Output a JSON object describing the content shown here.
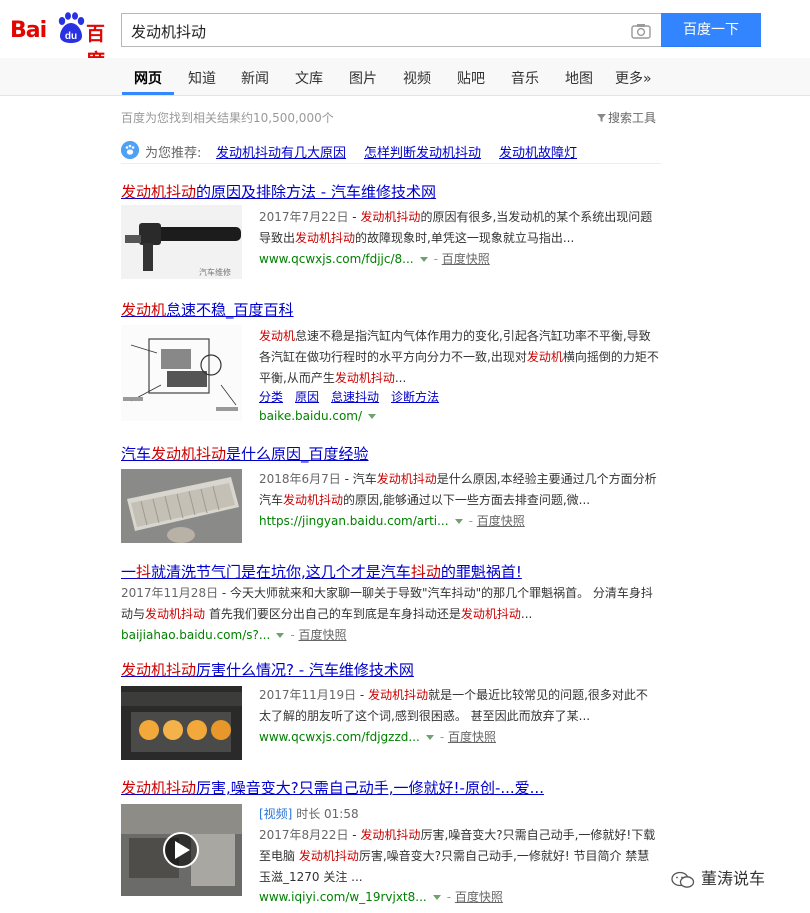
{
  "header": {
    "logo_left": "Bai",
    "logo_du": "du",
    "logo_right": "百度",
    "query": "发动机抖动",
    "search_button": "百度一下"
  },
  "tabs": [
    {
      "label": "网页",
      "active": true
    },
    {
      "label": "知道"
    },
    {
      "label": "新闻"
    },
    {
      "label": "文库"
    },
    {
      "label": "图片"
    },
    {
      "label": "视频"
    },
    {
      "label": "贴吧"
    },
    {
      "label": "音乐"
    },
    {
      "label": "地图"
    },
    {
      "label": "更多»"
    }
  ],
  "result_count": "百度为您找到相关结果约10,500,000个",
  "search_tools": "搜索工具",
  "recommend": {
    "label": "为您推荐:",
    "links": [
      "发动机抖动有几大原因",
      "怎样判断发动机抖动",
      "发动机故障灯"
    ]
  },
  "results": [
    {
      "title_hl": "发动机抖动",
      "title_rest": "的原因及排除方法 - 汽车维修技术网",
      "date": "2017年7月22日",
      "abstract_pre": " - ",
      "abstract_hl": "发动机抖动",
      "abstract_mid": "的原因有很多,当发动机的某个系统出现问题导致出",
      "abstract_hl2": "发动机抖动",
      "abstract_post": "的故障现象时,单凭这一现象就立马指出...",
      "url": "www.qcwxjs.com/fdjjc/8...",
      "snapshot": "百度快照"
    },
    {
      "title_hl": "发动机",
      "title_rest": "怠速不稳_百度百科",
      "abstract_hl": "发动机",
      "abstract_mid": "怠速不稳是指汽缸内气体作用力的变化,引起各汽缸功率不平衡,导致各汽缸在做功行程时的水平方向分力不一致,出现对",
      "abstract_hl2": "发动机",
      "abstract_mid2": "横向摇倒的力矩不平衡,从而产生",
      "abstract_hl3": "发动机抖动",
      "abstract_post": "...",
      "sublinks": [
        "分类",
        "原因",
        "怠速抖动",
        "诊断方法"
      ],
      "url": "baike.baidu.com/"
    },
    {
      "title_pre": "汽车",
      "title_hl": "发动机抖动",
      "title_rest": "是什么原因_百度经验",
      "date": "2018年6月7日",
      "abstract_pre": " - 汽车",
      "abstract_hl": "发动机抖动",
      "abstract_mid": "是什么原因,本经验主要通过几个方面分析汽车",
      "abstract_hl2": "发动机抖动",
      "abstract_post": "的原因,能够通过以下一些方面去排查问题,微...",
      "url": "https://jingyan.baidu.com/arti...",
      "snapshot": "百度快照"
    },
    {
      "title_pre": "一",
      "title_hl": "抖",
      "title_mid": "就清洗节气门是在坑你,这几个才是汽车",
      "title_hl2": "抖动",
      "title_rest": "的罪魁祸首!",
      "date": "2017年11月28日",
      "abstract_pre": " - 今天大师就来和大家聊一聊关于导致\"汽车抖动\"的那几个罪魁祸首。 分清车身抖动与",
      "abstract_hl": "发动机抖动",
      "abstract_mid": " 首先我们要区分出自己的车到底是车身抖动还是",
      "abstract_hl2": "发动机抖动",
      "abstract_post": "...",
      "url": "baijiahao.baidu.com/s?...",
      "snapshot": "百度快照"
    },
    {
      "title_hl": "发动机抖动",
      "title_rest": "厉害什么情况? - 汽车维修技术网",
      "date": "2017年11月19日",
      "abstract_pre": " - ",
      "abstract_hl": "发动机抖动",
      "abstract_mid": "就是一个最近比较常见的问题,很多对此不太了解的朋友听了这个词,感到很困惑。 甚至因此而放弃了某...",
      "url": "www.qcwxjs.com/fdjgzzd...",
      "snapshot": "百度快照"
    },
    {
      "title_hl": "发动机抖动",
      "title_rest": "厉害,噪音变大?只需自己动手,一修就好!-原创-...爱...",
      "video_tag": "[视频]",
      "duration": " 时长 01:58",
      "date": "2017年8月22日",
      "abstract_pre": " - ",
      "abstract_hl": "发动机抖动",
      "abstract_mid": "厉害,噪音变大?只需自己动手,一修就好!下载至电脑 ",
      "abstract_hl2": "发动机抖动",
      "abstract_post": "厉害,噪音变大?只需自己动手,一修就好! 节目简介 禁慧玉滋_1270 关注 ...",
      "url": "www.iqiyi.com/w_19rvjxt8...",
      "snapshot": "百度快照"
    }
  ],
  "watermark": "董涛说车",
  "colors": {
    "brand_red": "#e10602",
    "link_blue": "#0000cc",
    "highlight": "#cc0000",
    "url_green": "#008000",
    "button_blue": "#3385ff"
  }
}
